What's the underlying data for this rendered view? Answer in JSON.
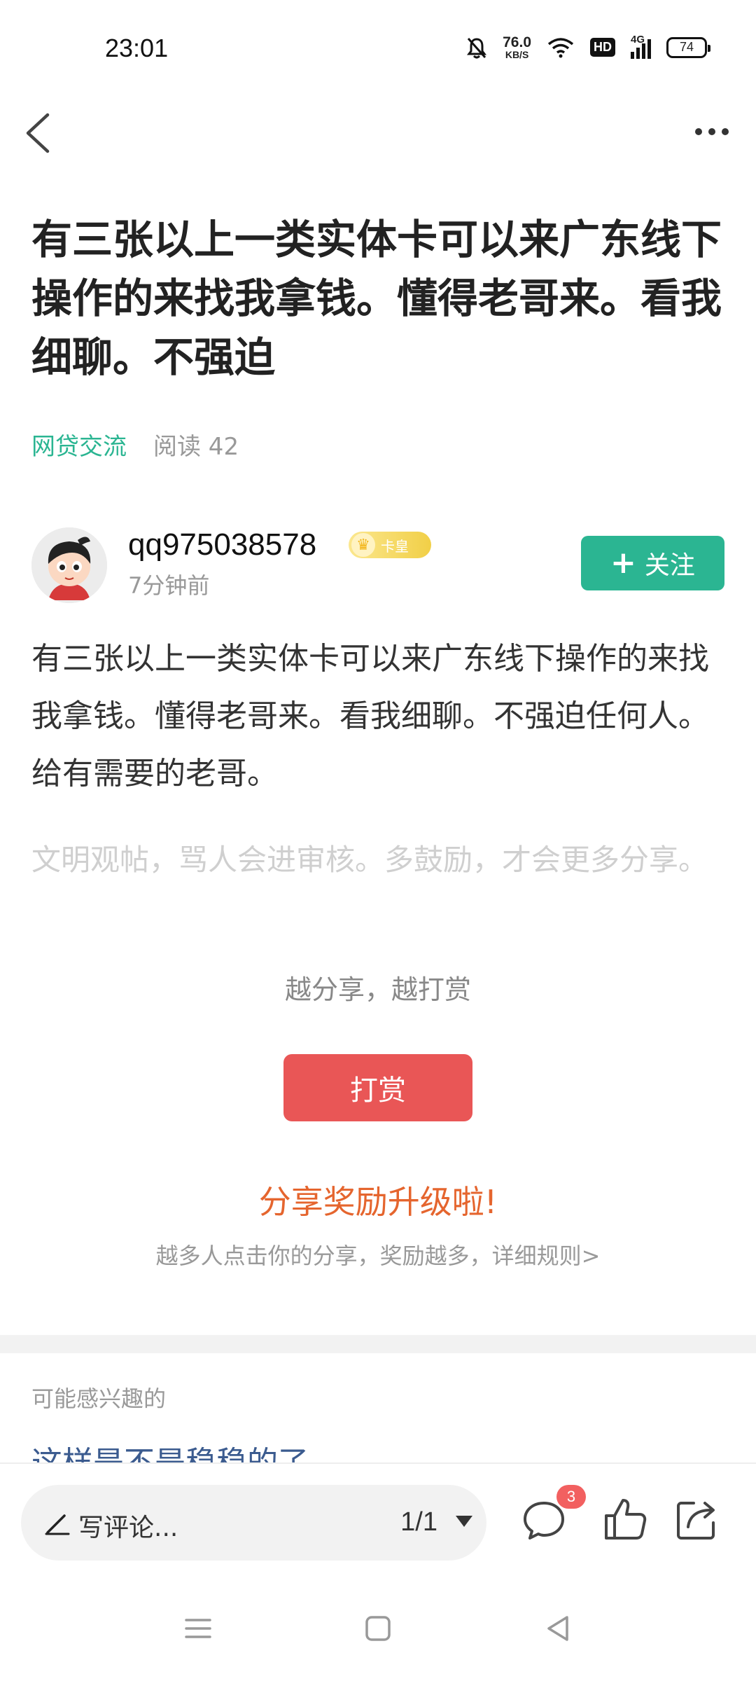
{
  "status_bar": {
    "time": "23:01",
    "net_speed": "76.0",
    "net_unit": "KB/S",
    "hd_label": "HD",
    "network_type": "4G",
    "battery": "74"
  },
  "nav": {
    "back_icon": "chevron-left-icon",
    "more_icon": "more-horizontal-icon"
  },
  "post": {
    "title": "有三张以上一类实体卡可以来广东线下操作的来找我拿钱。懂得老哥来。看我细聊。不强迫",
    "category": "网贷交流",
    "reads": "阅读 42",
    "author": {
      "name": "qq975038578",
      "level_badge": "卡皇",
      "time": "7分钟前",
      "follow_label": "关注"
    },
    "body": "有三张以上一类实体卡可以来广东线下操作的来找我拿钱。懂得老哥来。看我细聊。不强迫任何人。给有需要的老哥。",
    "hint": "文明观帖，骂人会进审核。多鼓励，才会更多分享。"
  },
  "reward": {
    "slogan": "越分享，越打赏",
    "button_label": "打赏"
  },
  "share_promo": {
    "title": "分享奖励升级啦!",
    "rule": "越多人点击你的分享，奖励越多，详细规则>"
  },
  "related": {
    "header": "可能感兴趣的",
    "items": [
      "这样是不是稳稳的了"
    ]
  },
  "bottom_bar": {
    "comment_placeholder": "写评论...",
    "page_indicator": "1/1",
    "comment_count": "3"
  },
  "colors": {
    "accent_green": "#2bb592",
    "reward_red": "#e95656",
    "promo_orange": "#e5652e",
    "link_blue": "#3b5b8f"
  }
}
